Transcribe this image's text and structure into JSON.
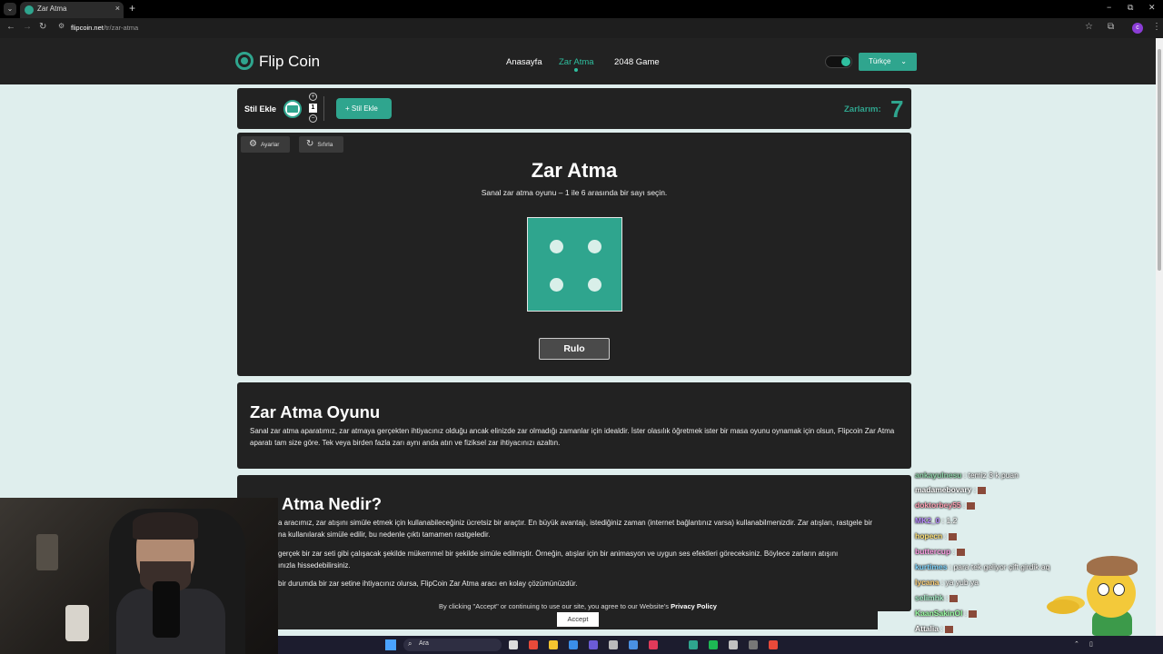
{
  "browser": {
    "tab_title": "Zar Atma",
    "tab_close": "×",
    "new_tab": "+",
    "tab_menu": "⌄",
    "url_domain": "flipcoin.net",
    "url_path": "/tr/zar-atma",
    "profile_initial": "c",
    "window_minimize": "−",
    "window_restore": "⧉",
    "window_close": "✕"
  },
  "header": {
    "logo": "Flip Coin",
    "nav": [
      {
        "label": "Anasayfa",
        "active": false
      },
      {
        "label": "Zar Atma",
        "active": true
      },
      {
        "label": "2048 Game",
        "active": false
      }
    ],
    "language": "Türkçe"
  },
  "style_bar": {
    "label": "Stil Ekle",
    "count_value": "1",
    "plus": "+",
    "minus": "−",
    "add_button": "Stil Ekle",
    "dice_label": "Zarlarım:",
    "dice_count": "7"
  },
  "game": {
    "settings_label": "Ayarlar",
    "reset_label": "Sıfırla",
    "title": "Zar Atma",
    "subtitle": "Sanal zar atma oyunu – 1 ile 6 arasında bir sayı seçin.",
    "die_value": 4,
    "roll_button": "Rulo"
  },
  "sections": [
    {
      "title": "Zar Atma Oyunu",
      "paragraphs": [
        "Sanal zar atma aparatımız, zar atmaya gerçekten ihtiyacınız olduğu ancak elinizde zar olmadığı zamanlar için idealdir. İster olasılık öğretmek ister bir masa oyunu oynamak için olsun, Flipcoin Zar Atma aparatı tam size göre. Tek veya birden fazla zarı aynı anda atın ve fiziksel zar ihtiyacınızı azaltın."
      ]
    },
    {
      "title": "Atma Nedir?",
      "paragraphs": [
        "a aracımız, zar atışını simüle etmek için kullanabileceğiniz ücretsiz bir araçtır. En büyük avantajı, istediğiniz zaman (internet bağlantınız varsa) kullanabilmenizdir. Zar atışları, rastgele bir",
        "na kullanılarak simüle edilir, bu nedenle çıktı tamamen rastgeledir.",
        "gerçek bir zar seti gibi çalışacak şekilde mükemmel bir şekilde simüle edilmiştir. Örneğin, atışlar için bir animasyon ve uygun ses efektleri göreceksiniz. Böylece zarların atışını",
        "ınızla hissedebilirsiniz.",
        "bir durumda bir zar setine ihtiyacınız olursa, FlipCoin Zar Atma aracı en kolay çözümünüzdür."
      ]
    }
  ],
  "cookie": {
    "text": "By clicking \"Accept\" or continuing to use our site, you agree to our Website's",
    "link": "Privacy Policy",
    "accept": "Accept"
  },
  "chat": [
    {
      "user": "ankayulnesu",
      "msg": ": temiz 3 k puan",
      "color": "#8fd3a8"
    },
    {
      "user": "madamebovary",
      "msg": ":",
      "color": "#ffffff",
      "emote": true
    },
    {
      "user": "doktorbey55",
      "msg": ":",
      "color": "#ff9fb3",
      "emote": true
    },
    {
      "user": "MK2_0",
      "msg": ": 1.2",
      "color": "#b98cff"
    },
    {
      "user": "hopecn",
      "msg": ":",
      "color": "#ffe37a",
      "emote": true
    },
    {
      "user": "buttercup",
      "msg": ":",
      "color": "#ff9fe6",
      "emote": true
    },
    {
      "user": "kurtimes",
      "msg": ": para tek geliyor çift girdik aq",
      "color": "#7fd6ff"
    },
    {
      "user": "lycana",
      "msg": ": ya yub ya",
      "color": "#ffd27a"
    },
    {
      "user": "selimhk",
      "msg": ":",
      "color": "#a7f0c8",
      "emote": true
    },
    {
      "user": "KaanSakinOl",
      "msg": ":",
      "color": "#9cffa4",
      "emote": true
    },
    {
      "user": "Attalia",
      "msg": ":",
      "color": "#ffffff",
      "emote": true
    }
  ],
  "taskbar": {
    "search_placeholder": "Ara"
  },
  "colors": {
    "accent": "#2fa58e",
    "panel": "#222222",
    "page_bg": "#dfeeed"
  }
}
